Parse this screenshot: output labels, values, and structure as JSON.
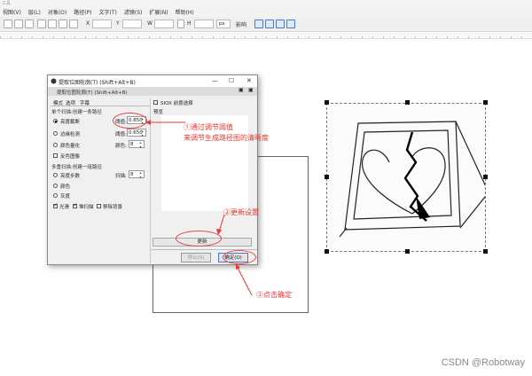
{
  "app": {
    "title_fragment": "工具",
    "menus": [
      "视图(V)",
      "层(L)",
      "对象(O)",
      "路径(P)",
      "文字(T)",
      "滤镜(S)",
      "扩展(N)",
      "帮助(H)"
    ],
    "toolbar": {
      "x_label": "X",
      "y_label": "Y",
      "w_label": "W",
      "h_label": "H",
      "unit": "px",
      "lock_label": "影响"
    }
  },
  "dialog": {
    "title": "提取位图轮廓(T) (Shift+Alt+B)",
    "subtitle": "提取位图轮廓(T) (Shift+Alt+B)",
    "tabs": [
      "模式",
      "选项",
      "字幕"
    ],
    "single_scan_group": "单个扫描:创建一条路径",
    "brightness_cutoff": "亮度截断",
    "threshold_label": "阈值:",
    "threshold_value": "0.850",
    "edge_detection": "边缘检测",
    "edge_value": "0.650",
    "color_quant": "颜色量化",
    "colors_label": "颜色:",
    "colors_value": "8",
    "invert_image": "反色图像",
    "multi_scan_group": "多重扫描:创建一组路径",
    "brightness_steps": "亮度步数",
    "scans_label": "扫描:",
    "scans_value": "8",
    "colors_opt": "颜色",
    "grays_opt": "灰度",
    "smooth": "光滑",
    "stack_scans": "堆扫描",
    "remove_bg": "移除背景",
    "siox": "SIOX 前景选择",
    "preview": "预览",
    "update_button": "更新",
    "stop_button": "停止(S)",
    "ok_button": "确定(O)"
  },
  "annotations": {
    "note1_line1": "①通过调节阈值",
    "note1_line2": "来调节生成路径图的清晰度",
    "note2": "②更新设置",
    "note3": "③点击确定",
    "color": "#e53935"
  },
  "watermark": "CSDN @Robotway"
}
